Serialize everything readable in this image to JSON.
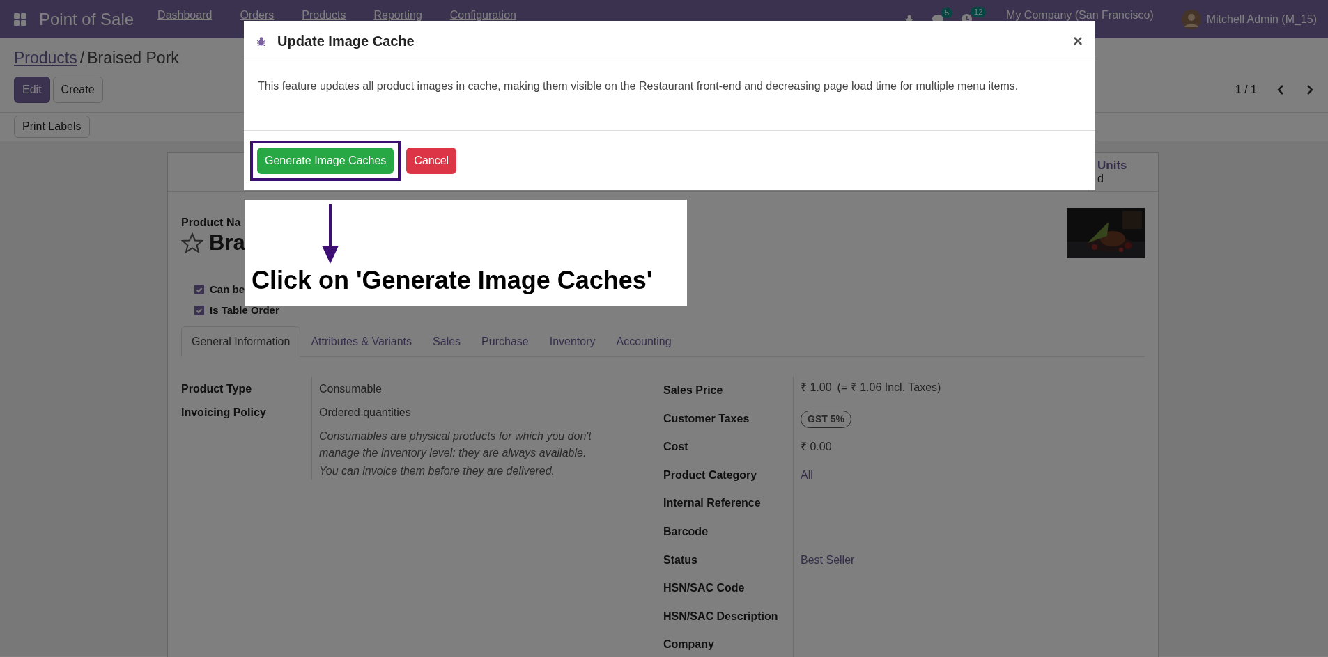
{
  "navbar": {
    "app_title": "Point of Sale",
    "menu": [
      "Dashboard",
      "Orders",
      "Products",
      "Reporting",
      "Configuration"
    ],
    "chat_count": "5",
    "activity_count": "12",
    "company": "My Company (San Francisco)",
    "user": "Mitchell Admin (M_15)"
  },
  "breadcrumb": {
    "parent": "Products",
    "separator": "/",
    "current": "Braised Pork"
  },
  "actions": [
    {
      "label": "Edit",
      "kind": "primary"
    },
    {
      "label": "Create",
      "kind": "secondary"
    }
  ],
  "pager": "1 / 1",
  "toolbar_button": "Print Labels",
  "form": {
    "stat_button": {
      "value": "Units",
      "caption": "d"
    },
    "product_name_label": "Product Na",
    "product_name": "Bra",
    "favorite": false,
    "checkboxes": [
      {
        "label": "Can be",
        "checked": true
      },
      {
        "label": "Is Table Order",
        "checked": true
      }
    ],
    "tabs": [
      {
        "label": "General Information",
        "selected": true
      },
      {
        "label": "Attributes & Variants",
        "selected": false
      },
      {
        "label": "Sales",
        "selected": false
      },
      {
        "label": "Purchase",
        "selected": false
      },
      {
        "label": "Inventory",
        "selected": false
      },
      {
        "label": "Accounting",
        "selected": false
      }
    ],
    "left_fields": [
      {
        "label": "Product Type",
        "value": "Consumable"
      },
      {
        "label": "Invoicing Policy",
        "value": "Ordered quantities"
      }
    ],
    "notes": [
      "Consumables are physical products for which you don't manage the inventory level: they are always available.",
      "You can invoice them before they are delivered."
    ],
    "right_fields": [
      {
        "label": "Sales Price",
        "kind": "price",
        "value": "₹ 1.00",
        "extra": "(= ₹ 1.06 Incl. Taxes)"
      },
      {
        "label": "Customer Taxes",
        "kind": "tag",
        "value": "GST 5%"
      },
      {
        "label": "Cost",
        "kind": "text",
        "value": "₹ 0.00"
      },
      {
        "label": "Product Category",
        "kind": "link",
        "value": "All"
      },
      {
        "label": "Internal Reference",
        "kind": "empty"
      },
      {
        "label": "Barcode",
        "kind": "empty"
      },
      {
        "label": "Status",
        "kind": "link",
        "value": "Best Seller"
      },
      {
        "label": "HSN/SAC Code",
        "kind": "empty"
      },
      {
        "label": "HSN/SAC Description",
        "kind": "empty"
      },
      {
        "label": "Company",
        "kind": "empty"
      }
    ]
  },
  "modal": {
    "title": "Update Image Cache",
    "close": "×",
    "body": "This feature updates all product images in cache, making them visible on the Restaurant front-end and decreasing page load time for multiple menu items.",
    "buttons": [
      {
        "label": "Generate Image Caches",
        "kind": "success",
        "highlighted": true
      },
      {
        "label": "Cancel",
        "kind": "danger",
        "highlighted": false
      }
    ]
  },
  "callout": {
    "text": "Click on 'Generate Image Caches'"
  }
}
